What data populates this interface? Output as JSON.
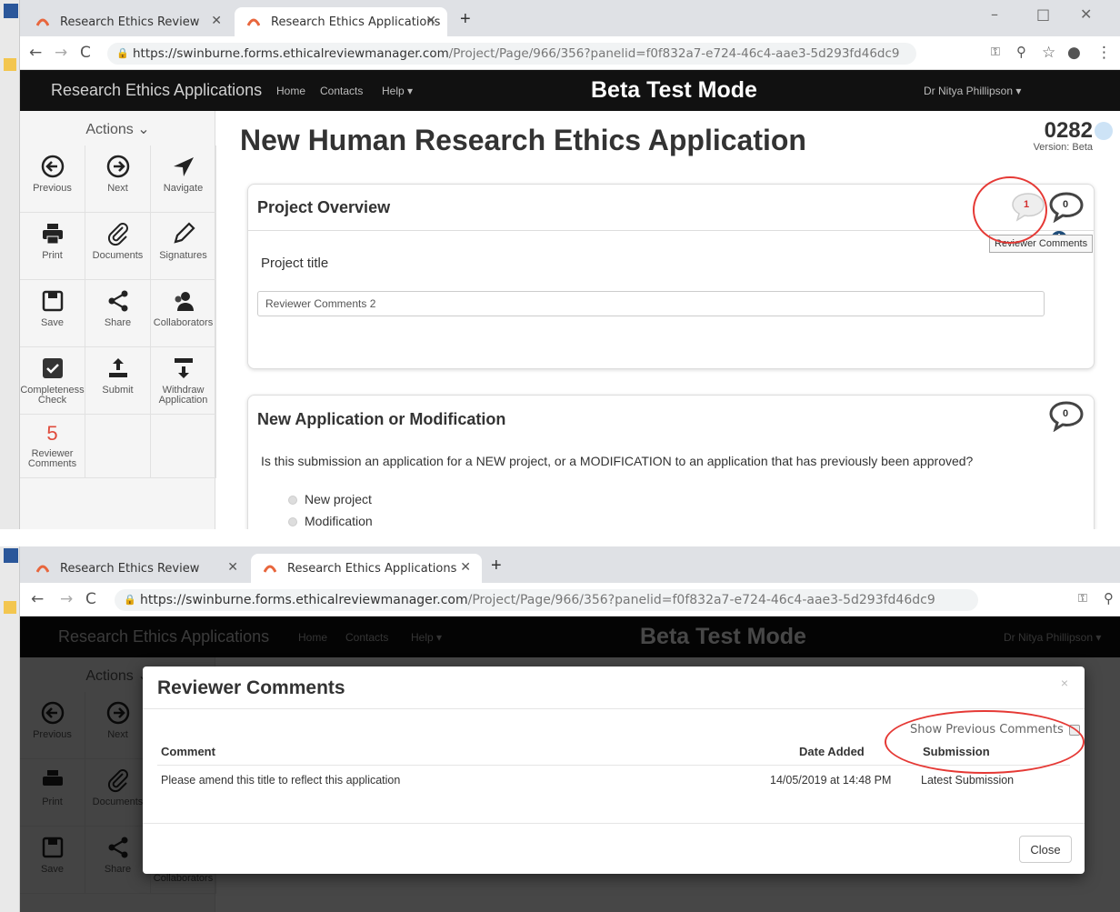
{
  "browser": {
    "tabs": [
      {
        "title": "Research Ethics Review"
      },
      {
        "title": "Research Ethics Applications"
      }
    ],
    "url": {
      "host": "https://swinburne.forms.ethicalreviewmanager.com",
      "path": "/Project/Page/966/356?panelid=f0f832a7-e724-46c4-aae3-5d293fd46dc9"
    }
  },
  "app": {
    "brand": "Research Ethics Applications",
    "nav": {
      "home": "Home",
      "contacts": "Contacts",
      "help": "Help ▾"
    },
    "mode": "Beta Test Mode",
    "user": "Dr Nitya Phillipson ▾"
  },
  "sidebar": {
    "header": "Actions ⌄",
    "actions": {
      "previous": "Previous",
      "next": "Next",
      "navigate": "Navigate",
      "print": "Print",
      "documents": "Documents",
      "signatures": "Signatures",
      "save": "Save",
      "share": "Share",
      "collaborators": "Collaborators",
      "completeness": "Completeness Check",
      "submit": "Submit",
      "withdraw": "Withdraw Application",
      "reviewer_count": "5",
      "reviewer": "Reviewer Comments"
    }
  },
  "page": {
    "title": "New Human Research Ethics Application",
    "app_id": "0282",
    "version": "Version: Beta"
  },
  "overview": {
    "heading": "Project Overview",
    "reviewer_count": "1",
    "comment_count": "0",
    "tooltip": "Reviewer Comments",
    "title_label": "Project title",
    "title_value": "Reviewer Comments 2"
  },
  "application": {
    "heading": "New Application or Modification",
    "comment_count": "0",
    "question": "Is this submission an application for a NEW project, or a MODIFICATION to an application that has previously been approved?",
    "options": [
      "New project",
      "Modification"
    ]
  },
  "modal": {
    "title": "Reviewer Comments",
    "close_x": "×",
    "show_previous": "Show Previous Comments",
    "columns": {
      "comment": "Comment",
      "date": "Date Added",
      "submission": "Submission"
    },
    "rows": [
      {
        "comment": "Please amend this title to reflect this application",
        "date": "14/05/2019 at 14:48 PM",
        "submission": "Latest Submission"
      }
    ],
    "close_button": "Close"
  }
}
